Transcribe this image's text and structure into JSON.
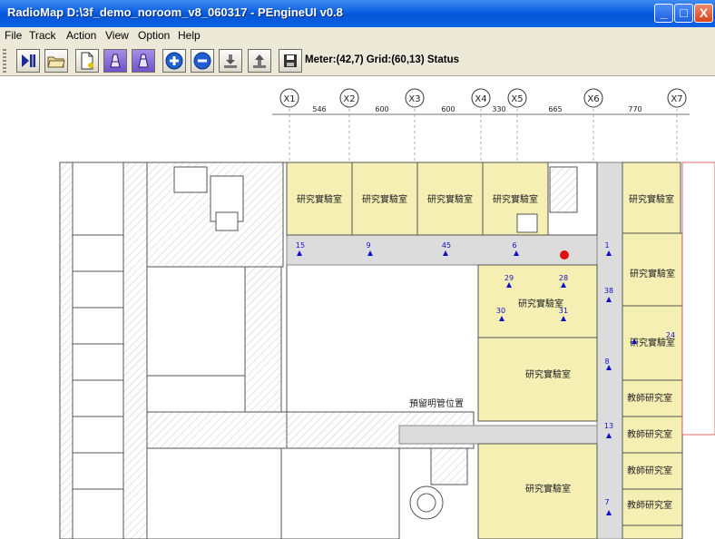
{
  "window": {
    "title": "RadioMap D:\\3f_demo_noroom_v8_060317 - PEngineUI v0.8",
    "min_label": "_",
    "max_label": "□",
    "close_label": "X"
  },
  "menu": [
    "File",
    "Track",
    "Action",
    "View",
    "Option",
    "Help"
  ],
  "toolbar": {
    "buttons": [
      "play-pause-icon",
      "open-folder-icon",
      "new-document-icon",
      "flag-icon",
      "flag-alt-icon",
      "zoom-in-icon",
      "zoom-out-icon",
      "download-icon",
      "upload-icon",
      "save-icon"
    ],
    "status": "Meter:(42,7) Grid:(60,13) Status"
  },
  "floorplan": {
    "axes": [
      "X1",
      "X2",
      "X3",
      "X4",
      "X5",
      "X6",
      "X7"
    ],
    "dimensions": [
      "546",
      "600",
      "600",
      "330",
      "665",
      "770"
    ],
    "lab_label": "研究實驗室",
    "office_label": "教師研究室",
    "reserved_label": "預留明管位置",
    "points": [
      "15",
      "9",
      "45",
      "6",
      "1",
      "29",
      "28",
      "38",
      "30",
      "31",
      "24",
      "8",
      "13",
      "7"
    ],
    "colors": {
      "room": "#f5efb4",
      "marker": "#1010c8",
      "current": "#e01010",
      "wall": "#555555"
    }
  }
}
